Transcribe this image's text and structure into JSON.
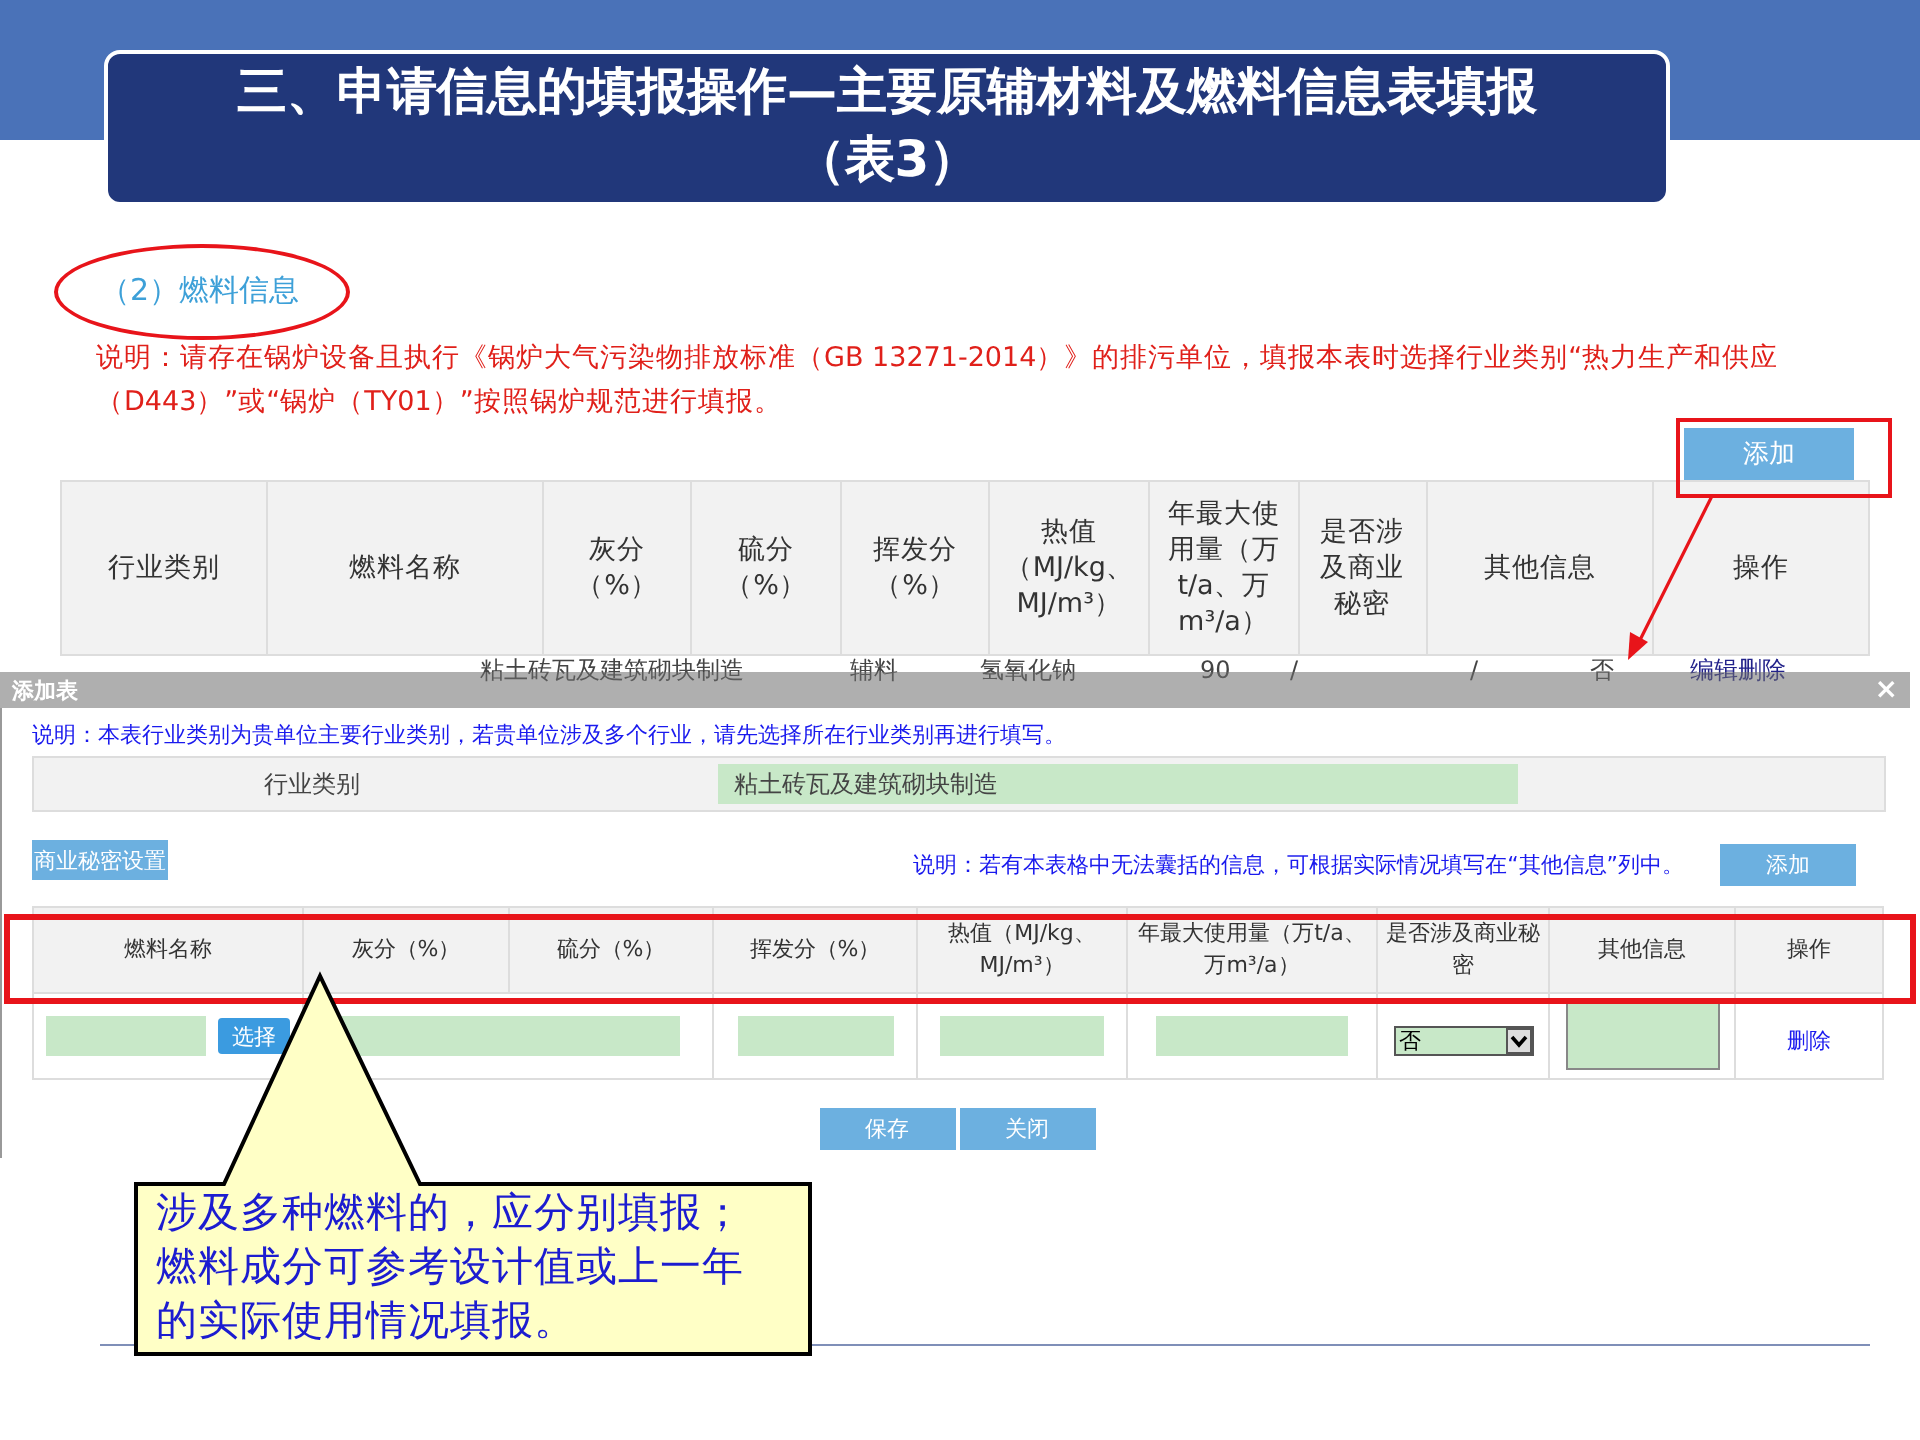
{
  "slide_title": {
    "lines": [
      "三、申请信息的填报操作—主要原辅材料及燃料信息表填报",
      "（表3）"
    ]
  },
  "section_heading": "（2）燃料信息",
  "notice": "说明：请存在锅炉设备且执行《锅炉大气污染物排放标准（GB 13271-2014）》的排污单位，填报本表时选择行业类别“热力生产和供应（D443）”或“锅炉（TY01）”按照锅炉规范进行填报。",
  "add_button": "添加",
  "main_table": {
    "columns": [
      "行业类别",
      "燃料名称",
      "灰分（%）",
      "硫分（%）",
      "挥发分（%）",
      "热值（MJ/kg、MJ/m³）",
      "年最大使用量（万t/a、万m³/a）",
      "是否涉及商业秘密",
      "其他信息",
      "操作"
    ],
    "row": [
      "粘土砖瓦及建筑砌块制造",
      "辅料",
      "氢氧化钠",
      "90",
      "/",
      "/",
      "否"
    ],
    "row_actions": [
      "编辑",
      "删除"
    ]
  },
  "dialog": {
    "title": "添加表",
    "close": "×",
    "note": "说明：本表行业类别为贵单位主要行业类别，若贵单位涉及多个行业，请先选择所在行业类别再进行填写。",
    "industry": {
      "label": "行业类别",
      "value": "粘土砖瓦及建筑砌块制造"
    },
    "secret_button": "商业秘密设置",
    "other_note": "说明：若有本表格中无法囊括的信息，可根据实际情况填写在“其他信息”列中。",
    "add_button": "添加",
    "table": {
      "columns": [
        "燃料名称",
        "灰分（%）",
        "硫分（%）",
        "挥发分（%）",
        "热值（MJ/kg、MJ/m³）",
        "年最大使用量（万t/a、万m³/a）",
        "是否涉及商业秘密",
        "其他信息",
        "操作"
      ],
      "row": {
        "choose_button": "选择",
        "secret": "否",
        "action": "删除"
      }
    },
    "buttons": [
      "保存",
      "关闭"
    ]
  },
  "callout": "涉及多种燃料的，应分别填报；燃料成分可参考设计值或上一年的实际使用情况填报。"
}
